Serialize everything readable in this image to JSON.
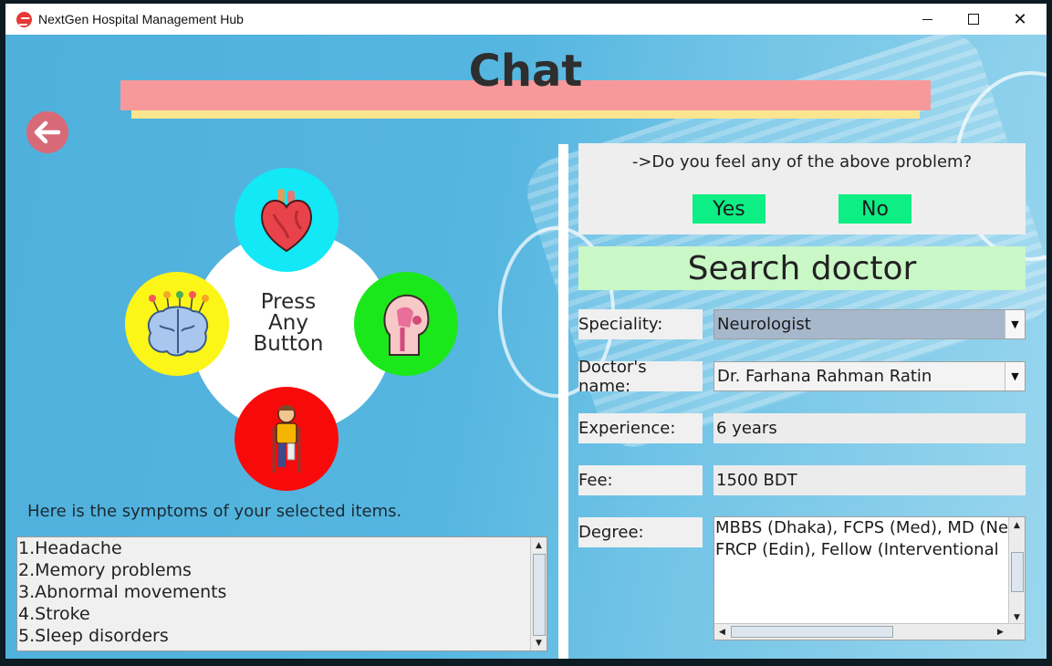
{
  "window": {
    "title": "NextGen Hospital Management Hub",
    "controls": [
      "minimize",
      "maximize",
      "close"
    ]
  },
  "header": {
    "title": "Chat"
  },
  "back_button": {
    "icon": "arrow-left-icon"
  },
  "symptom_wheel": {
    "center_text": [
      "Press",
      "Any",
      "Button"
    ],
    "buttons": [
      {
        "name": "heart",
        "icon": "heart-icon",
        "color": "#12e8f6"
      },
      {
        "name": "ent",
        "icon": "ent-head-icon",
        "color": "#1be81b"
      },
      {
        "name": "brain",
        "icon": "brain-icon",
        "color": "#fbf518"
      },
      {
        "name": "bone",
        "icon": "injured-person-icon",
        "color": "#f90a0a"
      }
    ]
  },
  "symptoms": {
    "caption": "Here is the symptoms of your selected items.",
    "items": [
      "1.Headache",
      "2.Memory problems",
      "3.Abnormal movements",
      "4.Stroke",
      "5.Sleep disorders"
    ]
  },
  "question": {
    "text": "->Do you feel any of the above problem?",
    "yes_label": "Yes",
    "no_label": "No"
  },
  "search": {
    "title": "Search doctor",
    "speciality_label": "Speciality:",
    "speciality_value": "Neurologist",
    "doctor_label": "Doctor's name:",
    "doctor_value": "Dr. Farhana Rahman Ratin",
    "experience_label": "Experience:",
    "experience_value": "6  years",
    "fee_label": "Fee:",
    "fee_value": "1500 BDT",
    "degree_label": "Degree:",
    "degree_lines": [
      "MBBS (Dhaka), FCPS (Med), MD (Ne",
      "FRCP (Edin), Fellow (Interventional"
    ]
  },
  "colors": {
    "chat_bar": "#f7999b",
    "chat_underline": "#fbe58e",
    "yes_no": "#0dee84",
    "search_header": "#c9f7c6",
    "back_button": "#d86a78"
  }
}
